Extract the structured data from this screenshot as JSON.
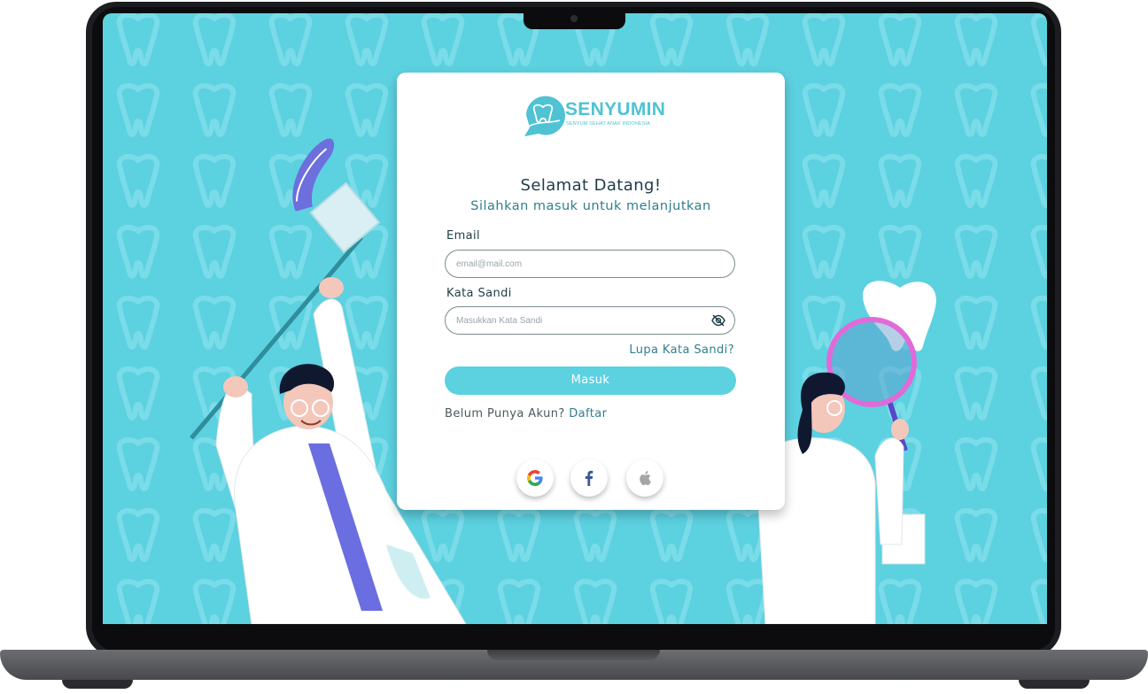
{
  "brand": {
    "name": "SENYUMIN",
    "tagline": "SENYUM SEHAT ANAK INDONESIA"
  },
  "login": {
    "title": "Selamat Datang!",
    "subtitle": "Silahkan masuk untuk melanjutkan",
    "email_label": "Email",
    "email_placeholder": "email@mail.com",
    "password_label": "Kata Sandi",
    "password_placeholder": "Masukkan Kata Sandi",
    "forgot_label": "Lupa Kata Sandi?",
    "submit_label": "Masuk",
    "signup_prompt": "Belum Punya Akun?",
    "signup_link": "Daftar"
  },
  "social": [
    {
      "name": "google",
      "icon": "google-icon"
    },
    {
      "name": "facebook",
      "icon": "facebook-icon"
    },
    {
      "name": "apple",
      "icon": "apple-icon"
    }
  ],
  "colors": {
    "background": "#5cd1e0",
    "accent": "#4fc3d4",
    "heading": "#1e3d45",
    "link": "#2f7f8d"
  }
}
